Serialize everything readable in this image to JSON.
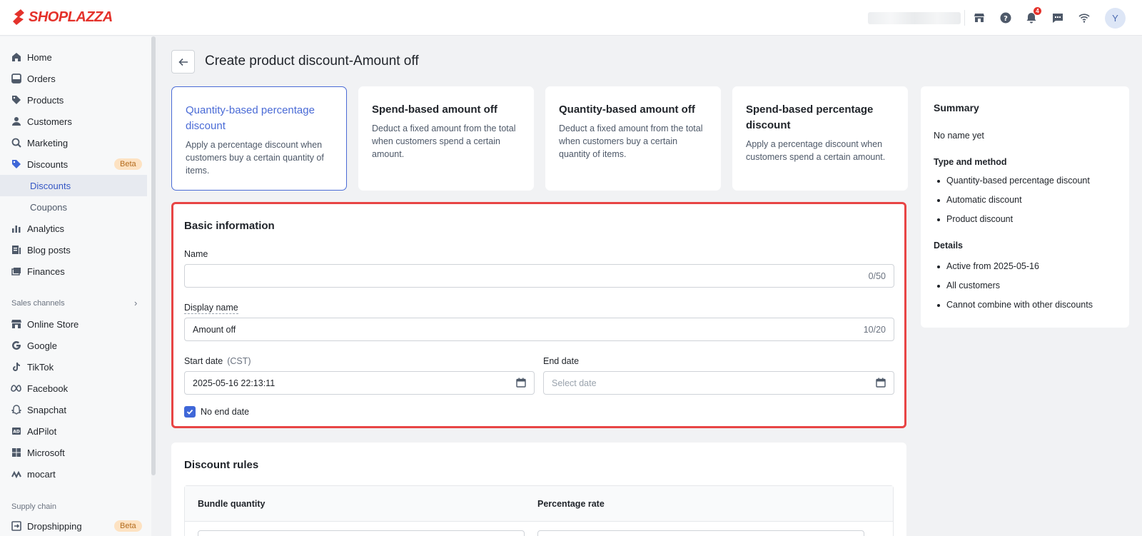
{
  "brand": {
    "name": "SHOPLAZZA",
    "color": "#e4322b"
  },
  "topbar": {
    "icons": [
      "store-icon",
      "help-icon",
      "bell-icon",
      "chat-icon",
      "wifi-icon"
    ],
    "notification_count": "4",
    "avatar_initial": "Y"
  },
  "sidebar": {
    "items": [
      {
        "label": "Home",
        "icon": "home-icon"
      },
      {
        "label": "Orders",
        "icon": "orders-icon"
      },
      {
        "label": "Products",
        "icon": "tag-icon"
      },
      {
        "label": "Customers",
        "icon": "person-icon"
      },
      {
        "label": "Marketing",
        "icon": "marketing-icon"
      },
      {
        "label": "Discounts",
        "icon": "discount-icon",
        "badge": "Beta"
      },
      {
        "label": "Discounts",
        "sub": true,
        "active": true
      },
      {
        "label": "Coupons",
        "sub": true
      },
      {
        "label": "Analytics",
        "icon": "analytics-icon"
      },
      {
        "label": "Blog posts",
        "icon": "blog-icon"
      },
      {
        "label": "Finances",
        "icon": "finances-icon"
      }
    ],
    "sales_channels_heading": "Sales channels",
    "sales_channels": [
      {
        "label": "Online Store",
        "icon": "store-icon"
      },
      {
        "label": "Google",
        "icon": "google-icon"
      },
      {
        "label": "TikTok",
        "icon": "tiktok-icon"
      },
      {
        "label": "Facebook",
        "icon": "meta-icon"
      },
      {
        "label": "Snapchat",
        "icon": "snapchat-icon"
      },
      {
        "label": "AdPilot",
        "icon": "adpilot-icon"
      },
      {
        "label": "Microsoft",
        "icon": "microsoft-icon"
      },
      {
        "label": "mocart",
        "icon": "mocart-icon"
      }
    ],
    "supply_chain_heading": "Supply chain",
    "supply_chain": [
      {
        "label": "Dropshipping",
        "icon": "dropshipping-icon",
        "badge": "Beta"
      }
    ]
  },
  "page": {
    "title": "Create product discount-Amount off"
  },
  "discount_types": [
    {
      "title": "Quantity-based percentage discount",
      "desc": "Apply a percentage discount when customers buy a certain quantity of items.",
      "selected": true
    },
    {
      "title": "Spend-based amount off",
      "desc": "Deduct a fixed amount from the total when customers spend a certain amount.",
      "selected": false
    },
    {
      "title": "Quantity-based amount off",
      "desc": "Deduct a fixed amount from the total when customers buy a certain quantity of items.",
      "selected": false
    },
    {
      "title": "Spend-based percentage discount",
      "desc": "Apply a percentage discount when customers spend a certain amount.",
      "selected": false
    }
  ],
  "basic_info": {
    "title": "Basic information",
    "name_label": "Name",
    "name_value": "",
    "name_counter": "0/50",
    "display_name_label": "Display name",
    "display_name_value": "Amount off",
    "display_name_counter": "10/20",
    "start_date_label": "Start date",
    "start_date_tz": "(CST)",
    "start_date_value": "2025-05-16 22:13:11",
    "end_date_label": "End date",
    "end_date_placeholder": "Select date",
    "no_end_date_label": "No end date",
    "no_end_date_checked": true
  },
  "discount_rules": {
    "title": "Discount rules",
    "columns": [
      "Bundle quantity",
      "Percentage rate"
    ]
  },
  "summary": {
    "title": "Summary",
    "name_text": "No name yet",
    "type_heading": "Type and method",
    "type_items": [
      "Quantity-based percentage discount",
      "Automatic discount",
      "Product discount"
    ],
    "details_heading": "Details",
    "details_items": [
      "Active from 2025-05-16",
      "All customers",
      "Cannot combine with other discounts"
    ]
  },
  "colors": {
    "accent": "#4a6bd6",
    "highlight_border": "#e84545",
    "beta_pill": "#fde2c2"
  }
}
